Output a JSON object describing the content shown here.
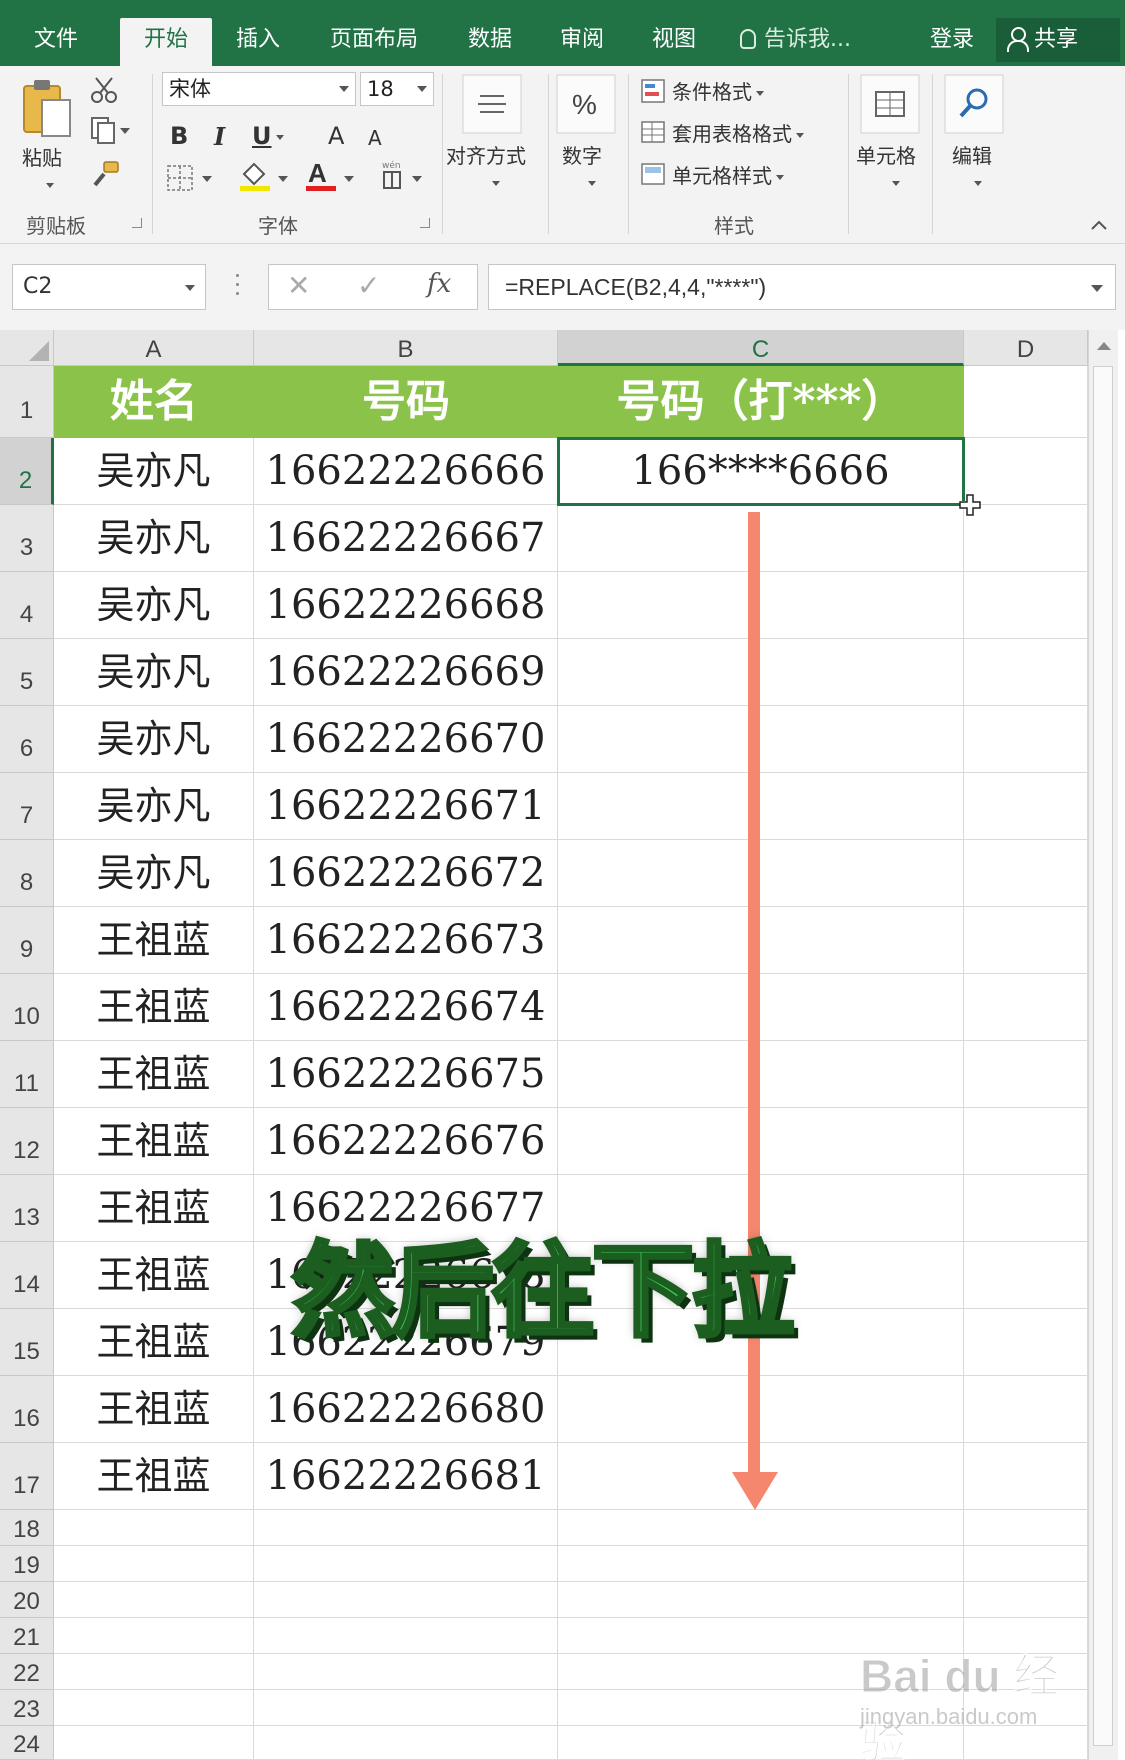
{
  "menu": {
    "tabs": [
      {
        "label": "文件"
      },
      {
        "label": "开始"
      },
      {
        "label": "插入"
      },
      {
        "label": "页面布局"
      },
      {
        "label": "数据"
      },
      {
        "label": "审阅"
      },
      {
        "label": "视图"
      }
    ],
    "active_tab": "开始",
    "tell_me": "告诉我...",
    "login": "登录",
    "share": "共享"
  },
  "ribbon": {
    "clipboard": {
      "paste": "粘贴",
      "label": "剪贴板"
    },
    "font": {
      "name": "宋体",
      "size": "18",
      "label": "字体",
      "bold": "B",
      "italic": "I",
      "underline": "U",
      "grow": "A",
      "shrink": "A",
      "font_color_glyph": "A",
      "phonetic": "wén"
    },
    "alignment": {
      "label": "对齐方式"
    },
    "number": {
      "label": "数字",
      "glyph": "%"
    },
    "styles": {
      "conditional": "条件格式",
      "table": "套用表格格式",
      "cell_styles": "单元格样式",
      "label": "样式"
    },
    "cells": {
      "label": "单元格"
    },
    "editing": {
      "label": "编辑"
    },
    "colors": {
      "brand": "#217346",
      "header_fill": "#8bc34a"
    }
  },
  "formula_bar": {
    "name_box": "C2",
    "cancel": "✕",
    "enter": "✓",
    "fx": "fx",
    "formula": "=REPLACE(B2,4,4,\"****\")"
  },
  "sheet": {
    "columns": [
      "A",
      "B",
      "C",
      "D"
    ],
    "selected_column": "C",
    "row_numbers": [
      "1",
      "2",
      "3",
      "4",
      "5",
      "6",
      "7",
      "8",
      "9",
      "10",
      "11",
      "12",
      "13",
      "14",
      "15",
      "16",
      "17",
      "18",
      "19",
      "20",
      "21",
      "22",
      "23",
      "24"
    ],
    "selected_row": "2",
    "header": [
      "姓名",
      "号码",
      "号码（打***）"
    ],
    "rows": [
      {
        "name": "吴亦凡",
        "number": "16622226666",
        "masked": "166****6666"
      },
      {
        "name": "吴亦凡",
        "number": "16622226667",
        "masked": ""
      },
      {
        "name": "吴亦凡",
        "number": "16622226668",
        "masked": ""
      },
      {
        "name": "吴亦凡",
        "number": "16622226669",
        "masked": ""
      },
      {
        "name": "吴亦凡",
        "number": "16622226670",
        "masked": ""
      },
      {
        "name": "吴亦凡",
        "number": "16622226671",
        "masked": ""
      },
      {
        "name": "吴亦凡",
        "number": "16622226672",
        "masked": ""
      },
      {
        "name": "王祖蓝",
        "number": "16622226673",
        "masked": ""
      },
      {
        "name": "王祖蓝",
        "number": "16622226674",
        "masked": ""
      },
      {
        "name": "王祖蓝",
        "number": "16622226675",
        "masked": ""
      },
      {
        "name": "王祖蓝",
        "number": "16622226676",
        "masked": ""
      },
      {
        "name": "王祖蓝",
        "number": "16622226677",
        "masked": ""
      },
      {
        "name": "王祖蓝",
        "number": "16622226678",
        "masked": ""
      },
      {
        "name": "王祖蓝",
        "number": "16622226679",
        "masked": ""
      },
      {
        "name": "王祖蓝",
        "number": "16622226680",
        "masked": ""
      },
      {
        "name": "王祖蓝",
        "number": "16622226681",
        "masked": ""
      }
    ]
  },
  "overlay": {
    "caption": "然后往下拉",
    "arrow_color": "#f4876e",
    "caption_color": "#3ec65a"
  },
  "watermark": {
    "logo": "Bai du 经验",
    "url": "jingyan.baidu.com"
  }
}
